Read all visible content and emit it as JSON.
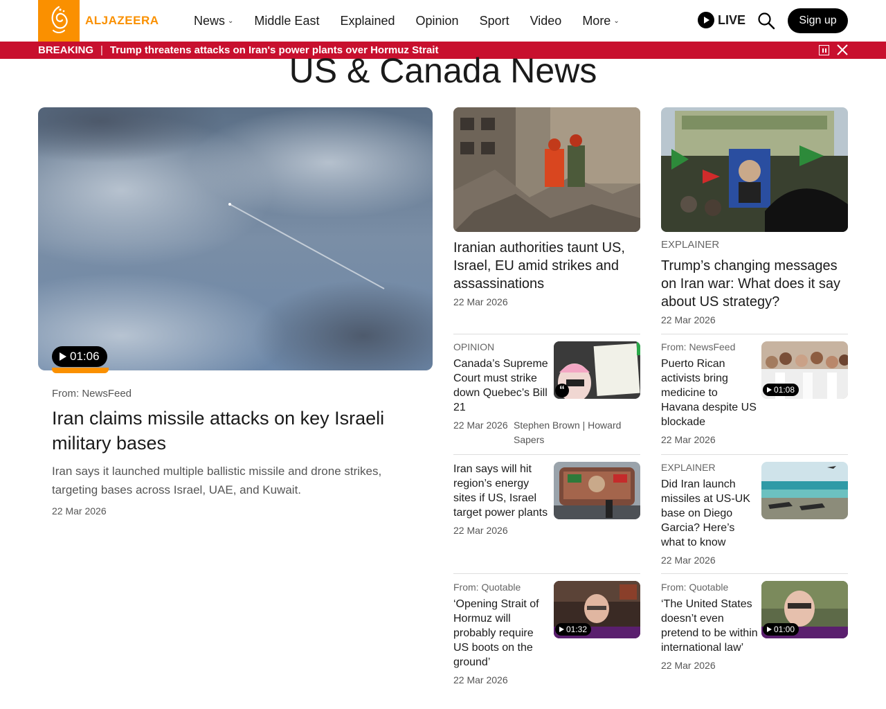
{
  "header": {
    "logo_text": "ALJAZEERA",
    "nav": [
      {
        "label": "News",
        "has_dropdown": true
      },
      {
        "label": "Middle East",
        "has_dropdown": false
      },
      {
        "label": "Explained",
        "has_dropdown": false
      },
      {
        "label": "Opinion",
        "has_dropdown": false
      },
      {
        "label": "Sport",
        "has_dropdown": false
      },
      {
        "label": "Video",
        "has_dropdown": false
      },
      {
        "label": "More",
        "has_dropdown": true
      }
    ],
    "live_label": "LIVE",
    "signup_label": "Sign up"
  },
  "breaking": {
    "tag": "BREAKING",
    "separator": "|",
    "text": "Trump threatens attacks on Iran's power plants over Hormuz Strait"
  },
  "page_title": "US & Canada News",
  "featured": {
    "duration": "01:06",
    "source": "From: NewsFeed",
    "headline": "Iran claims missile attacks on key Israeli military bases",
    "summary": "Iran says it launched multiple ballistic missile and drone strikes, targeting bases across Israel, UAE, and Kuwait.",
    "date": "22 Mar 2026"
  },
  "top_cards": [
    {
      "kicker": "",
      "headline": "Iranian authorities taunt US, Israel, EU amid strikes and assassinations",
      "date": "22 Mar 2026"
    },
    {
      "kicker": "EXPLAINER",
      "headline": "Trump’s changing messages on Iran war: What does it say about US strategy?",
      "date": "22 Mar 2026"
    }
  ],
  "small_cards": [
    {
      "kicker": "OPINION",
      "headline": "Canada’s Supreme Court must strike down Quebec’s Bill 21",
      "date": "22 Mar 2026",
      "authors": "Stephen Brown  |  Howard Sapers",
      "duration": "",
      "quote": true
    },
    {
      "kicker": "From: NewsFeed",
      "headline": "Puerto Rican activists bring medicine to Havana despite US blockade",
      "date": "22 Mar 2026",
      "authors": "",
      "duration": "01:08",
      "quote": false
    },
    {
      "kicker": "",
      "headline": "Iran says will hit region’s energy sites if US, Israel target power plants",
      "date": "22 Mar 2026",
      "authors": "",
      "duration": "",
      "quote": false
    },
    {
      "kicker": "EXPLAINER",
      "headline": "Did Iran launch missiles at US-UK base on Diego Garcia? Here’s what to know",
      "date": "22 Mar 2026",
      "authors": "",
      "duration": "",
      "quote": false
    },
    {
      "kicker": "From: Quotable",
      "headline": "‘Opening Strait of Hormuz will probably require US boots on the ground’",
      "date": "22 Mar 2026",
      "authors": "",
      "duration": "01:32",
      "quote": false
    },
    {
      "kicker": "From: Quotable",
      "headline": "‘The United States doesn’t even pretend to be within international law’",
      "date": "22 Mar 2026",
      "authors": "",
      "duration": "01:00",
      "quote": false
    }
  ],
  "colors": {
    "brand_orange": "#fa9000",
    "breaking_red": "#c8102e"
  }
}
